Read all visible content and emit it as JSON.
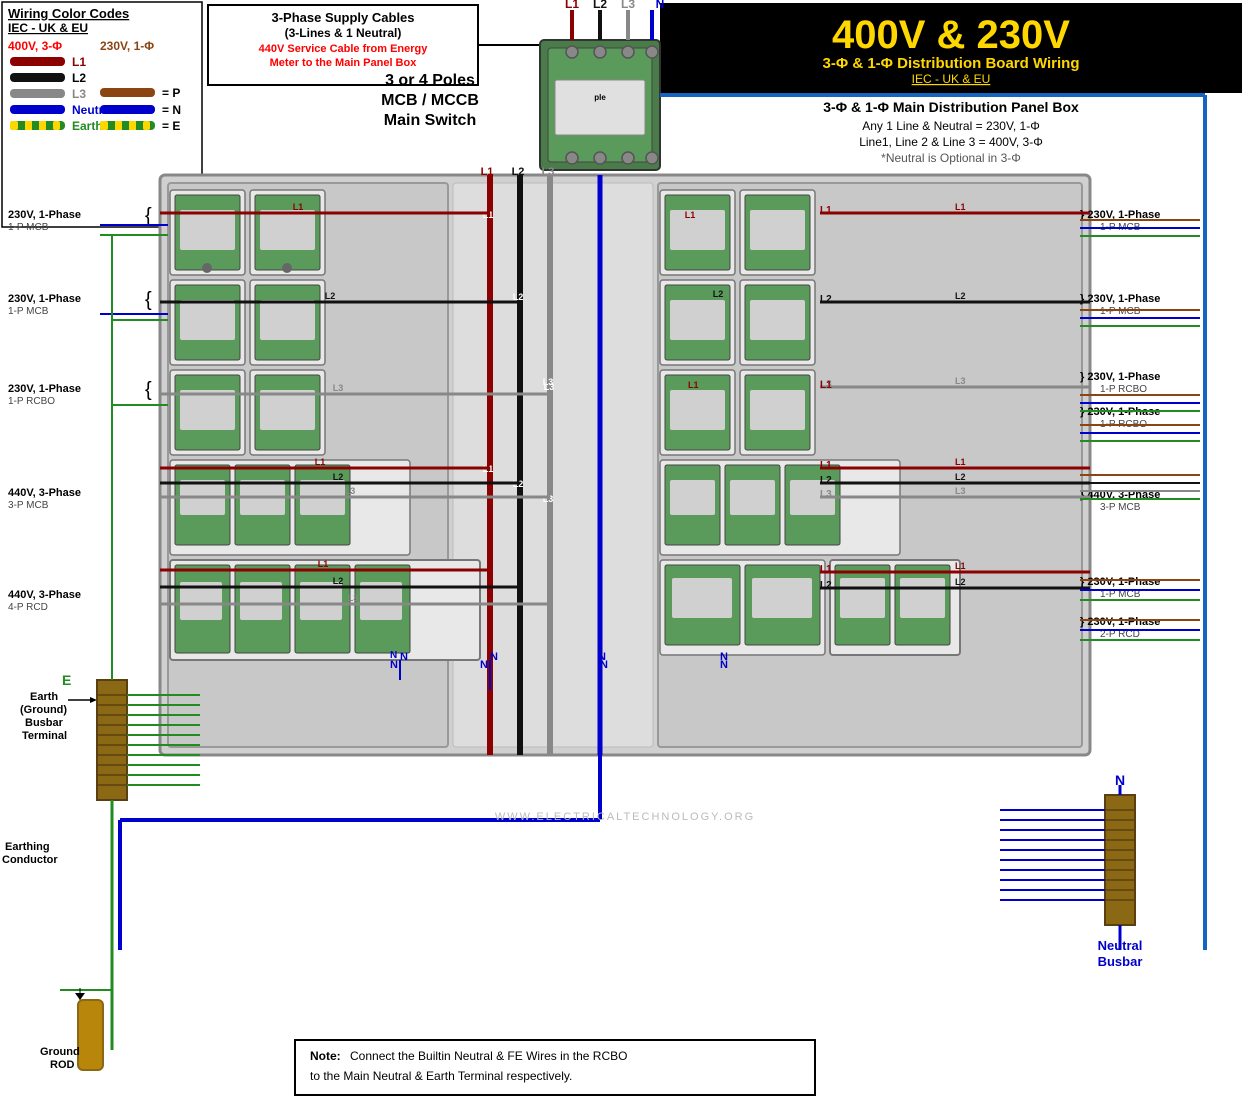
{
  "wiringCodes": {
    "title": "Wiring Color Codes",
    "subtitle": "IEC - UK & EU",
    "phase3label": "400V, 3-Φ",
    "wires3phase": [
      {
        "label": "L1",
        "color": "#8B0000",
        "wireColor": "#8B0000"
      },
      {
        "label": "L2",
        "color": "#000000",
        "wireColor": "#000000"
      },
      {
        "label": "L3",
        "color": "#888888",
        "wireColor": "#888888"
      },
      {
        "label": "Neutral",
        "color": "#00008B",
        "wireColor": "#00008B"
      },
      {
        "label": "Earth",
        "color": "#008000",
        "wireColor": "#228B22"
      }
    ],
    "phase1label": "230V, 1-Φ",
    "wires1phase": [
      {
        "symbol": "= P",
        "color": "#8B4513",
        "wireColor": "#8B4513"
      },
      {
        "symbol": "= N",
        "color": "#00008B",
        "wireColor": "#00008B"
      },
      {
        "symbol": "= E",
        "color": "#228B22",
        "wireColor": "#228B22"
      }
    ]
  },
  "supplyBox": {
    "title": "3-Phase Supply Cables",
    "subtitle": "(3-Lines & 1 Neutral)",
    "redText": "440V Service Cable from Energy Meter to the Main Panel Box"
  },
  "mainSwitch": {
    "label": "3 or 4 Poles\nMCB / MCCB\nMain Switch"
  },
  "mainTitle": {
    "voltages": "400V & 230V",
    "subtitle": "3-Φ & 1-Φ Distribution Board Wiring",
    "standard": "IEC - UK & EU"
  },
  "panelInfo": {
    "title": "3-Φ & 1-Φ Main Distribution Panel Box",
    "line1": "Any 1 Line & Neutral = 230V, 1-Φ",
    "line2": "Line1, Line 2 & Line 3 = 400V, 3-Φ",
    "line3": "*Neutral is Optional in 3-Φ"
  },
  "leftCircuits": [
    {
      "label": "230V, 1-Phase",
      "sub": "1-P MCB"
    },
    {
      "label": "230V, 1-Phase",
      "sub": "1-P MCB"
    },
    {
      "label": "230V, 1-Phase",
      "sub": "1-P RCBO"
    },
    {
      "label": "440V, 3-Phase",
      "sub": "3-P MCB"
    },
    {
      "label": "440V, 3-Phase",
      "sub": "4-P RCD"
    }
  ],
  "rightCircuits": [
    {
      "label": "230V, 1-Phase",
      "sub": "1-P MCB"
    },
    {
      "label": "230V, 1-Phase",
      "sub": "1-P MCB"
    },
    {
      "label": "230V, 1-Phase",
      "sub": "1-P RCBO"
    },
    {
      "label": "230V, 1-Phase",
      "sub": "1-P RCBO"
    },
    {
      "label": "440V, 3-Phase",
      "sub": "3-P MCB"
    },
    {
      "label": "230V, 1-Phase",
      "sub": "1-P MCB"
    },
    {
      "label": "230V, 1-Phase",
      "sub": "2-P RCD"
    }
  ],
  "earthSection": {
    "label": "E",
    "line1": "Earth",
    "line2": "(Ground)",
    "line3": "Busbar",
    "line4": "Terminal",
    "earthingConductor": "Earthing\nConductor",
    "groundRod": "Ground\nROD"
  },
  "neutralBusbar": {
    "label": "N",
    "title": "Neutral",
    "subtitle": "Busbar"
  },
  "noteBox": {
    "noteLabel": "Note:",
    "noteText": "Connect the Builtin Neutral & FE Wires in the RCBO\nto the Main Neutral & Earth Terminal respectively."
  },
  "watermark": "WWW.ELECTRICALTECHNOLOGY.ORG",
  "wireColors": {
    "L1": "#8B0000",
    "L2": "#1a1a1a",
    "L3": "#888888",
    "N": "#0000CD",
    "E": "#228B22",
    "blue": "#1565C0"
  }
}
